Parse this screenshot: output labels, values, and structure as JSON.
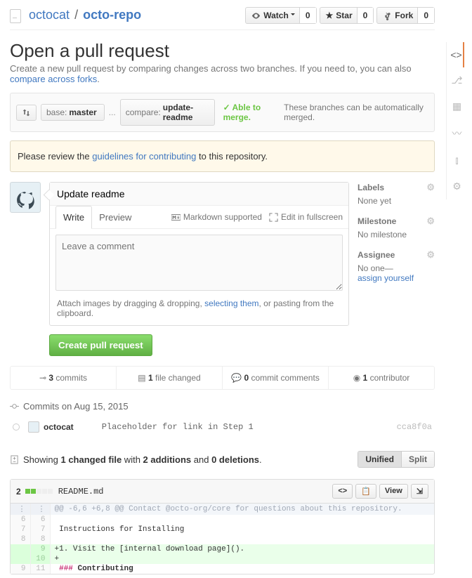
{
  "repo": {
    "owner": "octocat",
    "name": "octo-repo"
  },
  "actions": {
    "watch": "Watch",
    "watch_count": "0",
    "star": "Star",
    "star_count": "0",
    "fork": "Fork",
    "fork_count": "0"
  },
  "header": {
    "title": "Open a pull request",
    "subtitle_a": "Create a new pull request by comparing changes across two branches. If you need to, you can also ",
    "subtitle_link": "compare across forks",
    "subtitle_b": "."
  },
  "compare": {
    "base_lbl": "base:",
    "base": "master",
    "dots": "...",
    "compare_lbl": "compare:",
    "compare": "update-readme",
    "able": "Able to merge.",
    "msg": "These branches can be automatically merged."
  },
  "flash": {
    "a": "Please review the ",
    "link": "guidelines for contributing",
    "b": " to this repository."
  },
  "compose": {
    "title": "Update readme",
    "tab_write": "Write",
    "tab_preview": "Preview",
    "md": "Markdown supported",
    "full": "Edit in fullscreen",
    "placeholder": "Leave a comment",
    "drag_a": "Attach images by dragging & dropping, ",
    "drag_link": "selecting them",
    "drag_b": ", or pasting from the clipboard.",
    "submit": "Create pull request"
  },
  "side": {
    "labels_h": "Labels",
    "labels_v": "None yet",
    "milestone_h": "Milestone",
    "milestone_v": "No milestone",
    "assignee_h": "Assignee",
    "assignee_v1": "No one—",
    "assignee_link": "assign yourself"
  },
  "stats": {
    "commits_n": "3",
    "commits": "commits",
    "files_n": "1",
    "files": "file changed",
    "cc_n": "0",
    "cc": "commit comments",
    "contrib_n": "1",
    "contrib": "contributor"
  },
  "commits": {
    "group": "Commits on Aug 15, 2015",
    "author": "octocat",
    "msg": "Placeholder for link in Step 1",
    "sha": "cca8f0a"
  },
  "filesbar": {
    "a": "Showing ",
    "link": "1 changed file",
    "b": " with ",
    "add": "2 additions",
    "c": " and ",
    "del": "0 deletions",
    "d": ".",
    "unified": "Unified",
    "split": "Split"
  },
  "file": {
    "chg": "2",
    "name": "README.md",
    "view": "View"
  },
  "diff": {
    "hunk": "@@ -6,6 +6,8 @@ Contact @octo-org/core for questions about this repository.",
    "r1": {
      "o": "6",
      "n": "6",
      "t": ""
    },
    "r2": {
      "o": "7",
      "n": "7",
      "t": " Instructions for Installing"
    },
    "r3": {
      "o": "8",
      "n": "8",
      "t": ""
    },
    "r4": {
      "n": "9",
      "t": "+1. Visit the [internal download page]()."
    },
    "r5": {
      "n": "10",
      "t": "+"
    },
    "r6": {
      "o": "9",
      "n": "11",
      "t": " ### Contributing"
    }
  }
}
